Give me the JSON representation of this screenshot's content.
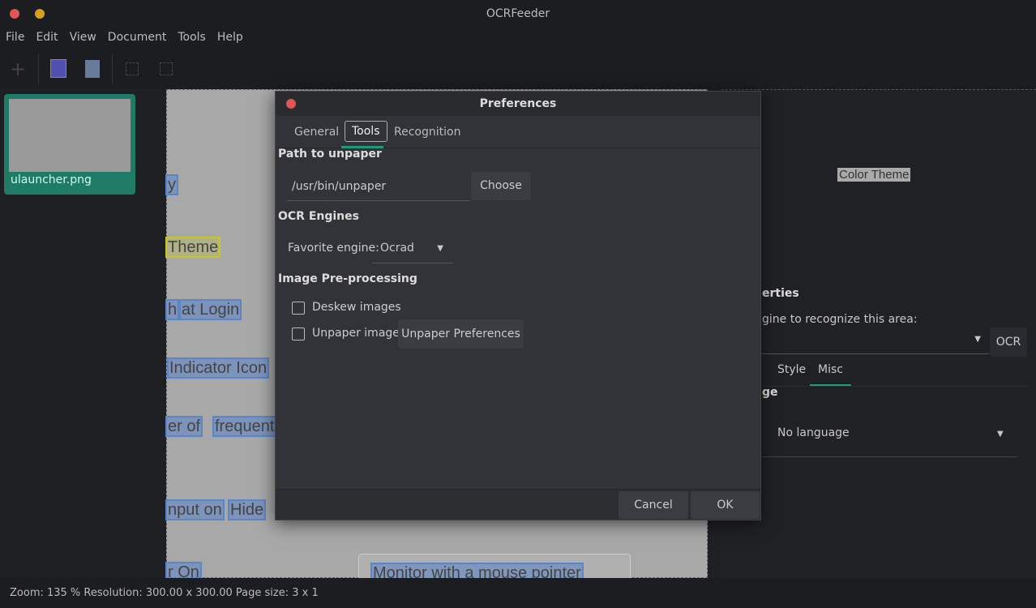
{
  "window": {
    "title": "OCRFeeder"
  },
  "menu": [
    "File",
    "Edit",
    "View",
    "Document",
    "Tools",
    "Help"
  ],
  "toolbar": {
    "icons": [
      "add-icon",
      "recognize-document-icon",
      "text-icon",
      "zoom-fit-icon",
      "zoom-expand-icon"
    ]
  },
  "pages": [
    {
      "label": "ulauncher.png"
    }
  ],
  "page_words": [
    "y",
    "Theme",
    "h",
    "at Login",
    "Indicator Icon",
    "er of",
    "frequent a",
    "nput on",
    "Hide",
    "r On",
    "Monitor with a mouse pointer"
  ],
  "right_panel": {
    "area_text": "Color Theme",
    "section_title": "erties",
    "engine_label": "gine to recognize this area:",
    "ocr_button": "OCR",
    "tabs": [
      "Style",
      "Misc"
    ],
    "active_tab": "Misc",
    "misc_title": "ge",
    "language": "No language"
  },
  "status": "Zoom: 135 % Resolution: 300.00 x 300.00 Page size: 3 x 1",
  "dialog": {
    "title": "Preferences",
    "tabs": [
      "General",
      "Tools",
      "Recognition"
    ],
    "active_tab": "Tools",
    "path_title": "Path to unpaper",
    "path_value": "/usr/bin/unpaper",
    "choose": "Choose",
    "engines_title": "OCR Engines",
    "favorite_label": "Favorite engine:",
    "favorite_value": "Ocrad",
    "preproc_title": "Image Pre-processing",
    "deskew": {
      "label": "Deskew images",
      "checked": false
    },
    "unpaper": {
      "label": "Unpaper images",
      "checked": false
    },
    "unpaper_prefs": "Unpaper Preferences",
    "cancel": "Cancel",
    "ok": "OK"
  },
  "colors": {
    "accent": "#1f7a66",
    "close": "#e05555",
    "minimize": "#d4a020"
  }
}
